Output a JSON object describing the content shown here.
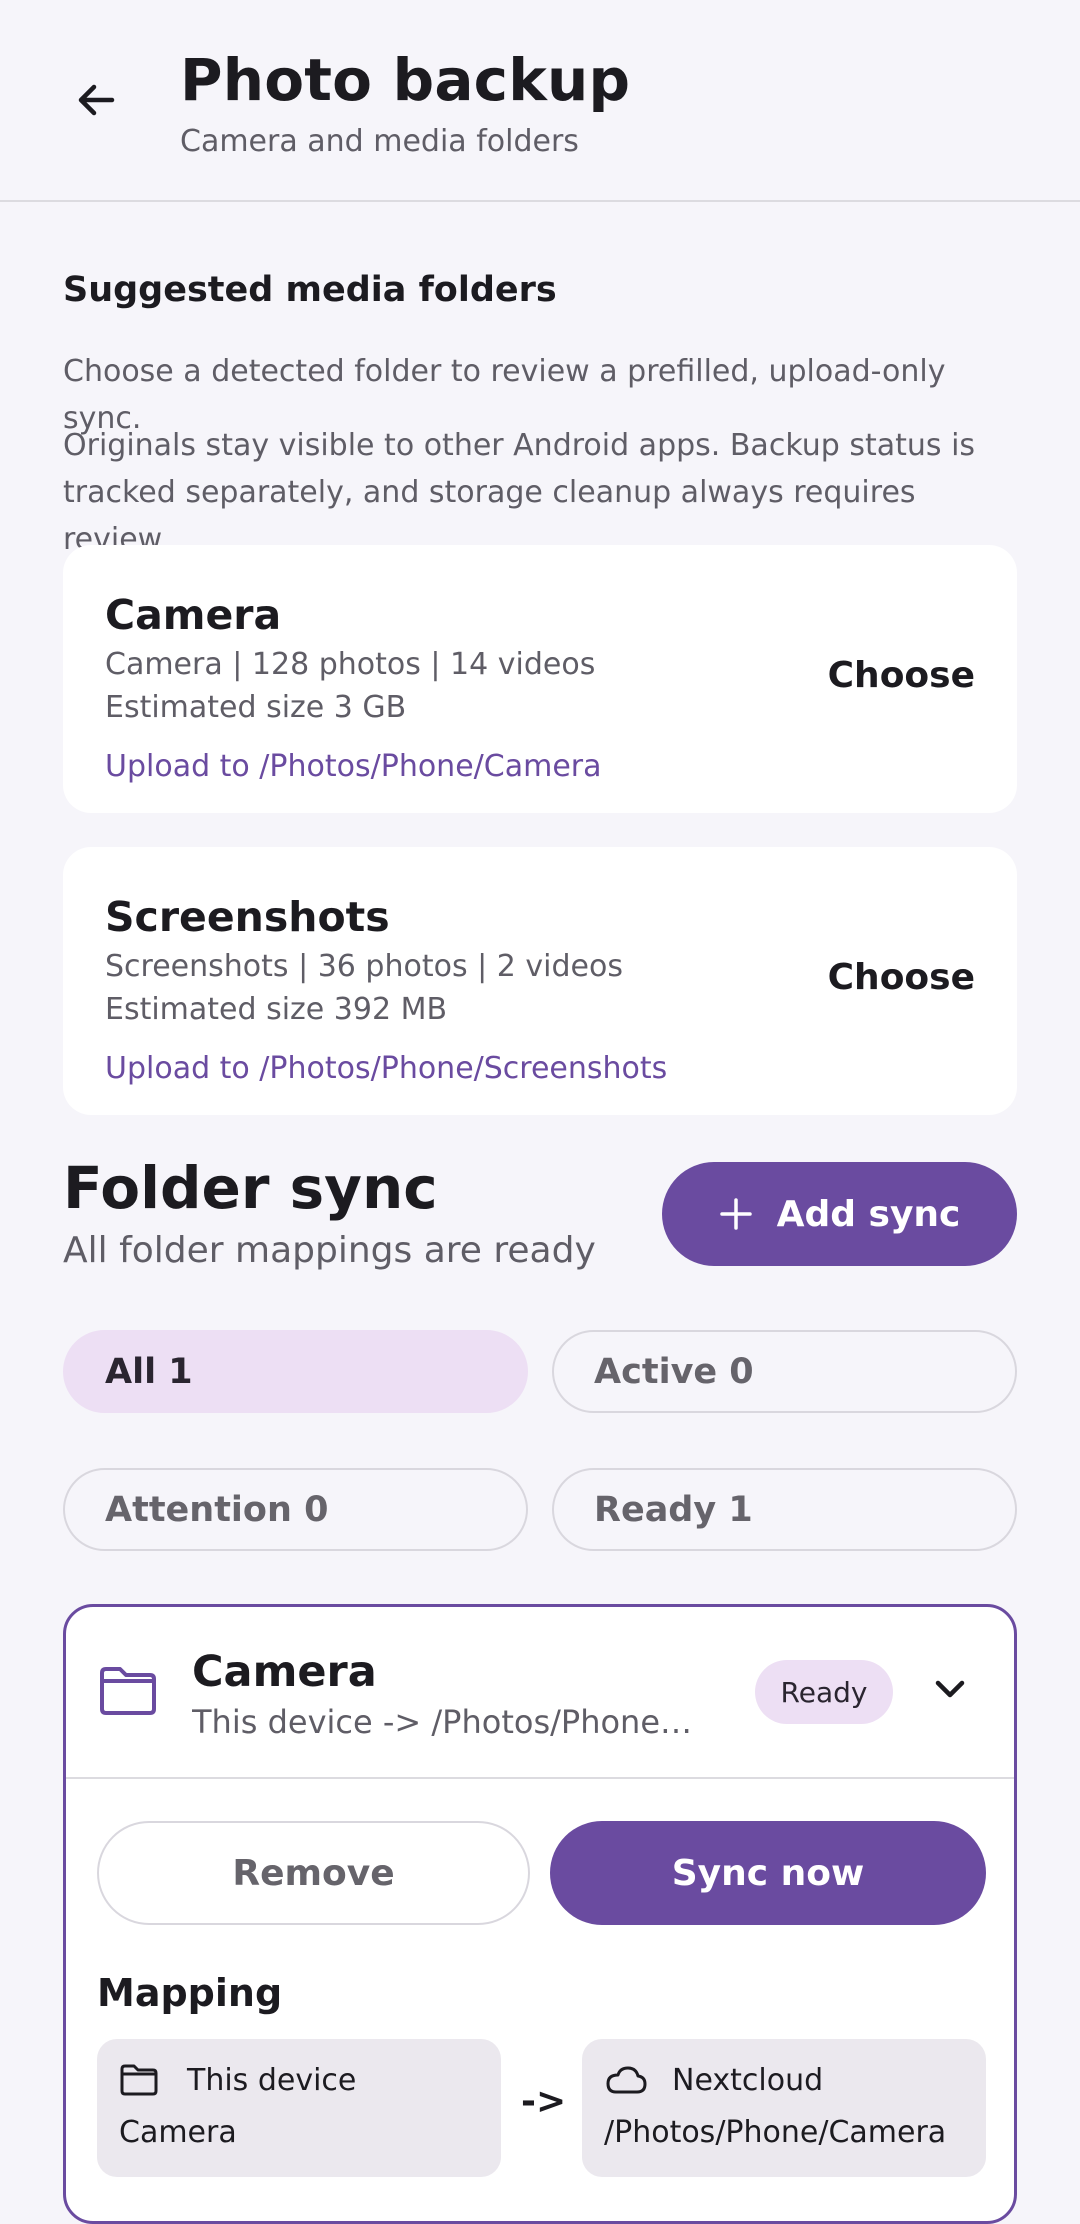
{
  "header": {
    "title": "Photo backup",
    "subtitle": "Camera and media folders"
  },
  "suggested": {
    "title": "Suggested media folders",
    "desc1": "Choose a detected folder to review a prefilled, upload-only sync.",
    "desc2": "Originals stay visible to other Android apps. Backup status is tracked separately, and storage cleanup always requires review.",
    "cards": [
      {
        "name": "Camera",
        "counts": "Camera | 128 photos | 14 videos",
        "size": "Estimated size 3 GB",
        "dest": "Upload to /Photos/Phone/Camera",
        "action": "Choose"
      },
      {
        "name": "Screenshots",
        "counts": "Screenshots | 36 photos | 2 videos",
        "size": "Estimated size 392 MB",
        "dest": "Upload to /Photos/Phone/Screenshots",
        "action": "Choose"
      }
    ]
  },
  "folder_sync": {
    "title": "Folder sync",
    "subtitle": "All folder mappings are ready",
    "add_label": "Add sync",
    "filters": [
      {
        "label": "All 1",
        "selected": true
      },
      {
        "label": "Active 0",
        "selected": false
      },
      {
        "label": "Attention 0",
        "selected": false
      },
      {
        "label": "Ready 1",
        "selected": false
      }
    ],
    "item": {
      "name": "Camera",
      "path": "This device -> /Photos/Phone/Camera",
      "status": "Ready",
      "remove_label": "Remove",
      "sync_label": "Sync now",
      "mapping_title": "Mapping",
      "source_label": "This device",
      "source_value": "Camera",
      "arrow": "->",
      "target_label": "Nextcloud",
      "target_value": "/Photos/Phone/Camera"
    }
  },
  "colors": {
    "accent": "#6a4ba0",
    "chip_selected": "#eddff4",
    "background": "#f6f5fa"
  }
}
